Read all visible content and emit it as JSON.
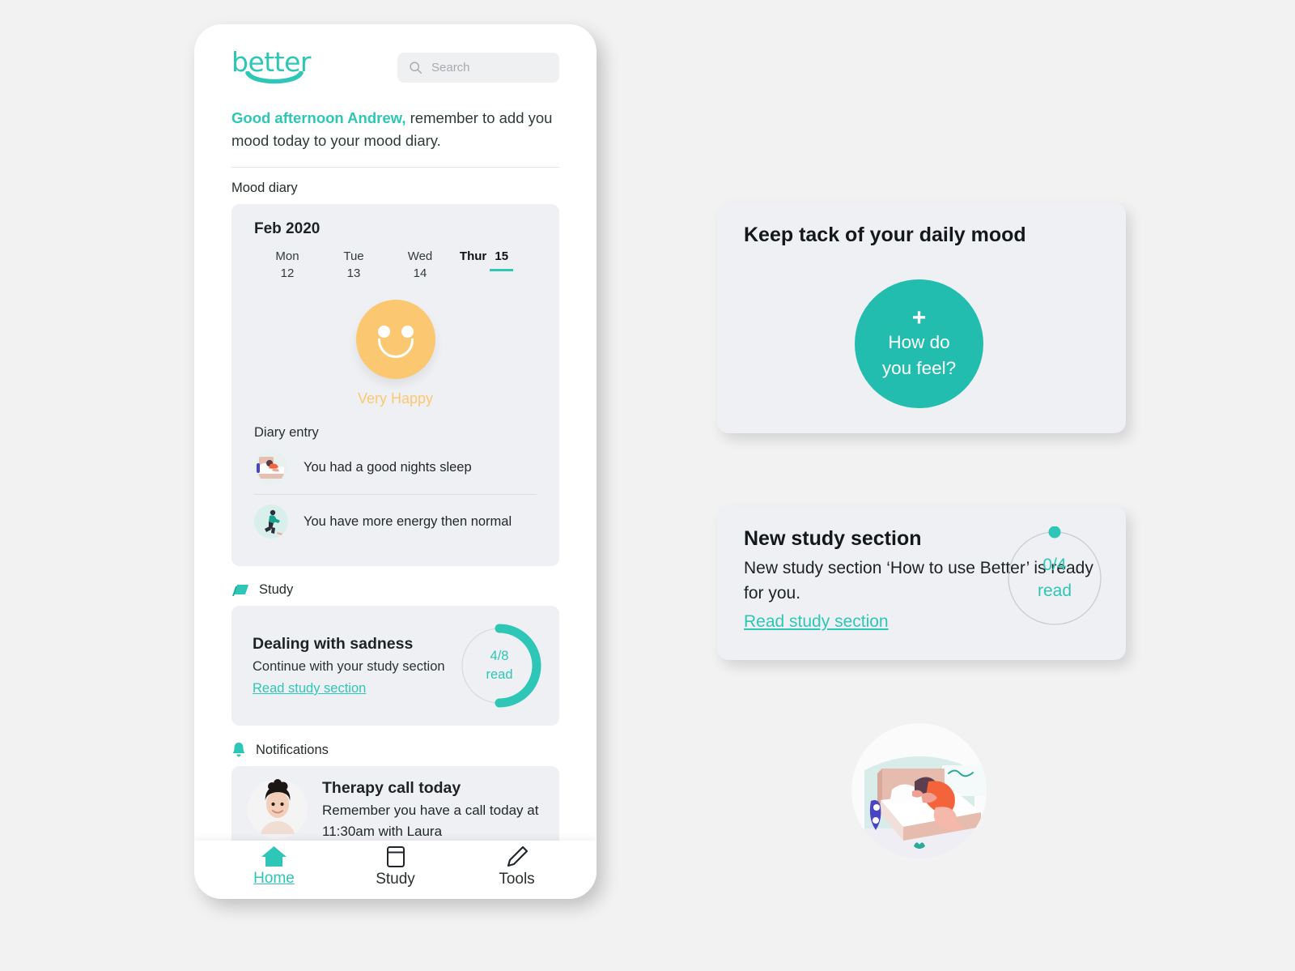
{
  "brand": {
    "name": "better",
    "accent": "#2ec6b6",
    "mood_color": "#fbc771",
    "card_bg": "#eff0f4"
  },
  "phone": {
    "search": {
      "placeholder": "Search",
      "icon": "search-icon"
    },
    "greeting": {
      "highlight": "Good afternoon Andrew,",
      "rest": " remember to add you mood today to your mood diary."
    },
    "mood_diary": {
      "label": "Mood diary",
      "month": "Feb 2020",
      "days": [
        {
          "name": "Mon",
          "num": "12",
          "active": false
        },
        {
          "name": "Tue",
          "num": "13",
          "active": false
        },
        {
          "name": "Wed",
          "num": "14",
          "active": false
        },
        {
          "name": "Thur",
          "num": "15",
          "active": true
        }
      ],
      "mood_label": "Very Happy",
      "mood_icon": "smiley-face-icon",
      "diary_entry_title": "Diary entry",
      "entries": [
        {
          "icon": "sleeping-in-bed-icon",
          "text": "You had a good nights sleep"
        },
        {
          "icon": "running-person-icon",
          "text": "You have more energy then normal"
        }
      ]
    },
    "study": {
      "label": "Study",
      "label_icon": "book-icon",
      "title": "Dealing with sadness",
      "subtitle": "Continue with your study section",
      "link": "Read study section",
      "progress": {
        "current": 4,
        "total": 8,
        "value": "4/8",
        "unit": "read"
      }
    },
    "notifications": {
      "label": "Notifications",
      "label_icon": "bell-icon",
      "items": [
        {
          "avatar": "therapist-avatar",
          "title": "Therapy call today",
          "body": "Remember you have a call today at 11:30am with Laura"
        }
      ]
    },
    "tabbar": [
      {
        "label": "Home",
        "icon": "home-icon",
        "active": true
      },
      {
        "label": "Study",
        "icon": "book-icon",
        "active": false
      },
      {
        "label": "Tools",
        "icon": "pencil-icon",
        "active": false
      }
    ]
  },
  "panel": {
    "mood_promo": {
      "title": "Keep tack of your daily mood",
      "button_plus": "+",
      "button_line1": "How do",
      "button_line2": "you feel?"
    },
    "new_study": {
      "title": "New study section",
      "body": "New study section ‘How to use Better’ is ready for you.",
      "link": "Read study section",
      "progress": {
        "current": 0,
        "total": 4,
        "value": "0/4",
        "unit": "read"
      }
    },
    "illustration": {
      "name": "sleeping-in-bed-illustration"
    }
  }
}
